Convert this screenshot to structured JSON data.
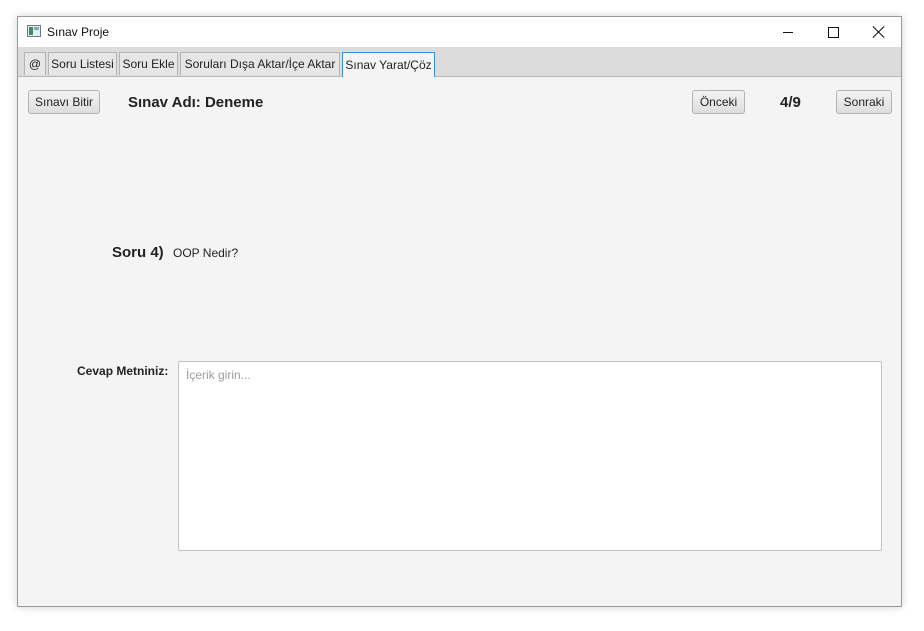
{
  "window": {
    "title": "Sınav Proje"
  },
  "tabs": [
    {
      "label": "@"
    },
    {
      "label": "Soru Listesi"
    },
    {
      "label": "Soru Ekle"
    },
    {
      "label": "Soruları Dışa Aktar/İçe Aktar"
    },
    {
      "label": "Sınav Yarat/Çöz",
      "active": true
    }
  ],
  "toolbar": {
    "finish_label": "Sınavı Bitir",
    "exam_title": "Sınav Adı: Deneme",
    "prev_label": "Önceki",
    "counter": "4/9",
    "next_label": "Sonraki"
  },
  "question": {
    "label": "Soru 4)",
    "text": "OOP Nedir?"
  },
  "answer": {
    "label": "Cevap Metniniz:",
    "placeholder": "İçerik girin...",
    "value": ""
  },
  "icons": [
    "app-icon",
    "minimize-icon",
    "maximize-icon",
    "close-icon"
  ]
}
